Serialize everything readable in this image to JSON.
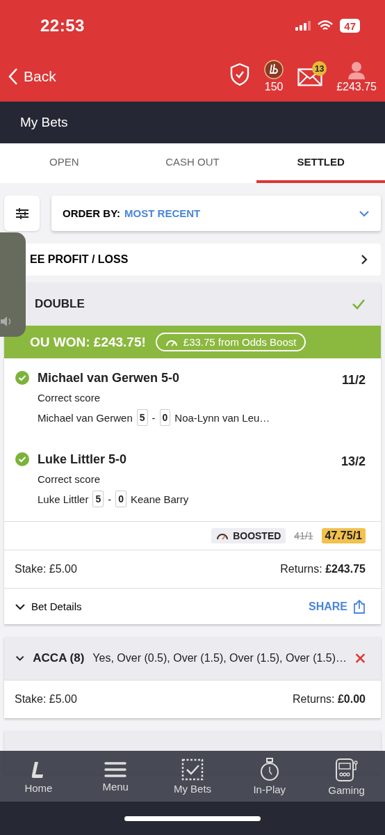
{
  "status_bar": {
    "time": "22:53",
    "battery": "47"
  },
  "header": {
    "back": "Back",
    "points": "150",
    "messages_badge": "13",
    "balance": "£243.75"
  },
  "page_title": "My Bets",
  "tabs": [
    {
      "label": "OPEN",
      "selected": false
    },
    {
      "label": "CASH OUT",
      "selected": false
    },
    {
      "label": "SETTLED",
      "selected": true
    }
  ],
  "order_by": {
    "label": "ORDER BY:",
    "value": "MOST RECENT"
  },
  "profit_loss_link": "EE PROFIT / LOSS",
  "bets": [
    {
      "type": "DOUBLE",
      "won": true,
      "banner": "OU WON: £243.75!",
      "boost_pill": "£33.75 from Odds Boost",
      "selections": [
        {
          "name": "Michael van Gerwen 5-0",
          "market": "Correct score",
          "home": "Michael van Gerwen",
          "home_score": "5",
          "separator": "-",
          "away_score": "0",
          "away": "Noa-Lynn van Leu…",
          "odds": "11/2",
          "won": true
        },
        {
          "name": "Luke Littler 5-0",
          "market": "Correct score",
          "home": "Luke Littler",
          "home_score": "5",
          "separator": "-",
          "away_score": "0",
          "away": "Keane Barry",
          "odds": "13/2",
          "won": true
        }
      ],
      "boost": {
        "label": "BOOSTED",
        "old_odds": "41/1",
        "new_odds": "47.75/1"
      },
      "stake": "Stake: £5.00",
      "returns": "Returns: **£243.75**",
      "details": "Bet Details",
      "share": "SHARE"
    },
    {
      "type": "ACCA (8)",
      "summary": "Yes, Over (0.5), Over (1.5), Over (1.5), Over (1.5)…",
      "won": false,
      "stake": "Stake: £5.00",
      "returns": "Returns: **£0.00**"
    }
  ],
  "nav": [
    {
      "label": "Home",
      "kind": "home"
    },
    {
      "label": "Menu",
      "kind": "menu"
    },
    {
      "label": "My Bets",
      "kind": "bets"
    },
    {
      "label": "In-Play",
      "kind": "inplay"
    },
    {
      "label": "Gaming",
      "kind": "gaming"
    }
  ]
}
